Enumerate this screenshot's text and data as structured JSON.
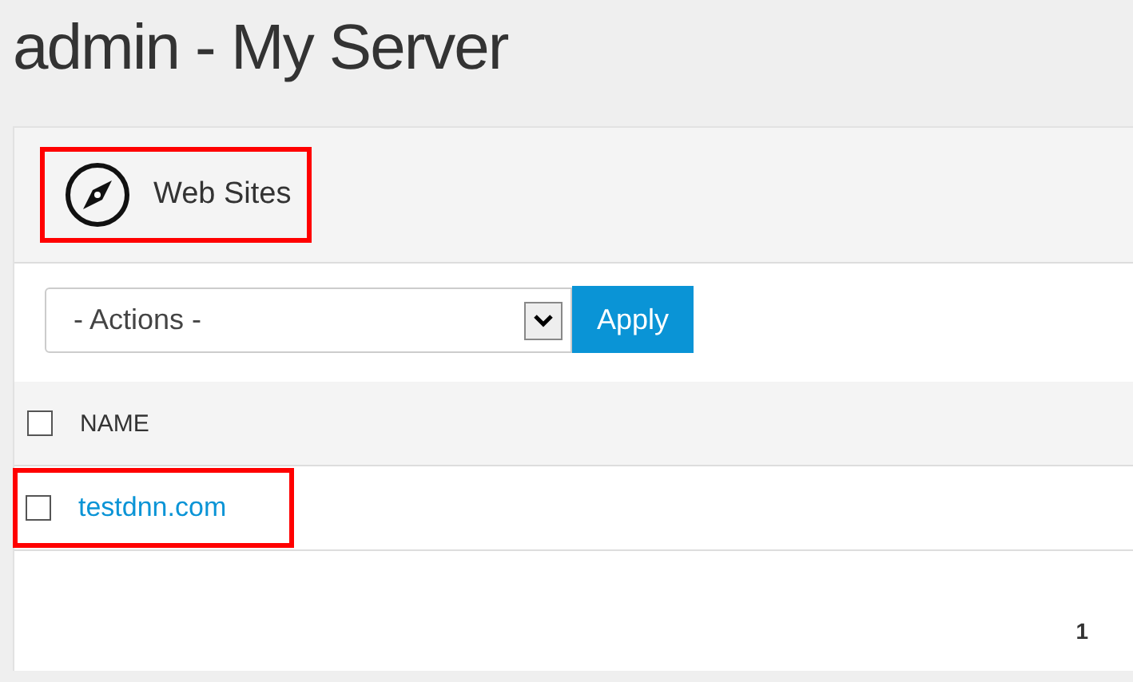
{
  "title": "admin - My Server",
  "panel": {
    "heading": "Web Sites",
    "highlighted": true
  },
  "actions": {
    "value": "- Actions -",
    "button": "Apply"
  },
  "table": {
    "select_all": {
      "checked": false
    },
    "columns": [
      "NAME"
    ],
    "rows": [
      {
        "name": "testdnn.com",
        "checked": false,
        "highlighted": true
      }
    ]
  },
  "pagination": [
    {
      "label": "1",
      "selected": true
    }
  ]
}
